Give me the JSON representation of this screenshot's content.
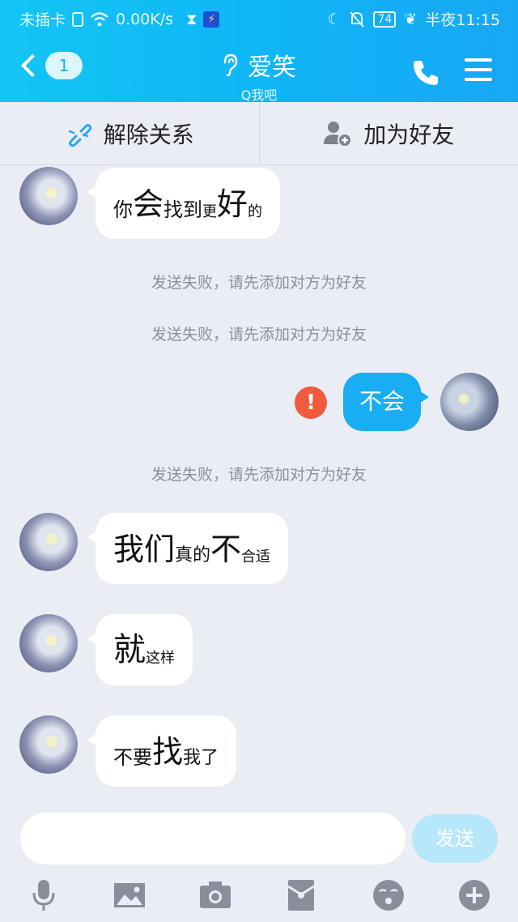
{
  "status_bar": {
    "carrier": "未插卡",
    "speed": "0.00K/s",
    "battery": "74",
    "time_label": "半夜11:15"
  },
  "header": {
    "back_badge": "1",
    "title": "爱笑",
    "subtitle": "Q我吧"
  },
  "actions": {
    "remove_relationship": "解除关系",
    "add_friend": "加为好友"
  },
  "messages": [
    {
      "side": "left",
      "segments": [
        {
          "text": "你",
          "size": "medium"
        },
        {
          "text": "会",
          "size": "large"
        },
        {
          "text": "找到",
          "size": "medium"
        },
        {
          "text": "更",
          "size": "small"
        },
        {
          "text": "好",
          "size": "large"
        },
        {
          "text": "的",
          "size": "small"
        }
      ]
    },
    {
      "side": "system",
      "text": "发送失败，请先添加对方为好友"
    },
    {
      "side": "system",
      "text": "发送失败，请先添加对方为好友"
    },
    {
      "side": "right",
      "failed": true,
      "segments": [
        {
          "text": "不会",
          "size": "medium"
        }
      ]
    },
    {
      "side": "system",
      "text": "发送失败，请先添加对方为好友"
    },
    {
      "side": "left",
      "segments": [
        {
          "text": "我们",
          "size": "large"
        },
        {
          "text": "真的",
          "size": "medium"
        },
        {
          "text": "不",
          "size": "large"
        },
        {
          "text": "合适",
          "size": "small"
        }
      ]
    },
    {
      "side": "left",
      "segments": [
        {
          "text": "就",
          "size": "large"
        },
        {
          "text": "这样",
          "size": "small"
        }
      ]
    },
    {
      "side": "left",
      "segments": [
        {
          "text": "不要",
          "size": "medium"
        },
        {
          "text": "找",
          "size": "large"
        },
        {
          "text": "我了",
          "size": "medium"
        }
      ]
    }
  ],
  "error_icon": "!",
  "composer": {
    "input_value": "",
    "send_label": "发送"
  },
  "toolbar_icons": [
    "microphone-icon",
    "image-icon",
    "camera-icon",
    "red-packet-icon",
    "emoji-icon",
    "plus-icon"
  ],
  "colors": {
    "header_blue": "#14c5f4",
    "bubble_blue": "#19aef4",
    "error_red": "#f15b3d",
    "send_disabled": "#b7e7fb"
  }
}
